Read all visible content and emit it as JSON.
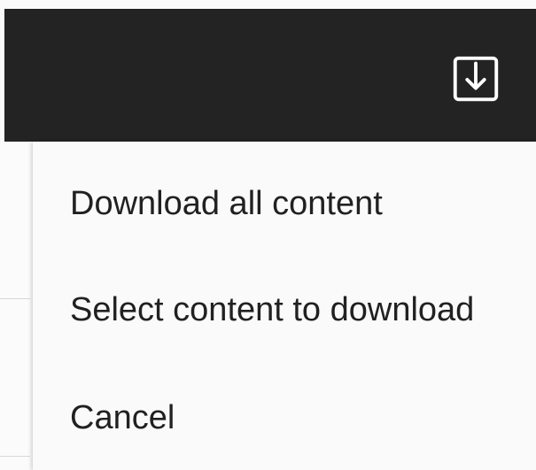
{
  "topbar": {
    "download_icon": "download-icon",
    "background_color": "#232323"
  },
  "dropdown": {
    "items": [
      {
        "label": "Download all content"
      },
      {
        "label": "Select content to download"
      },
      {
        "label": "Cancel"
      }
    ]
  }
}
